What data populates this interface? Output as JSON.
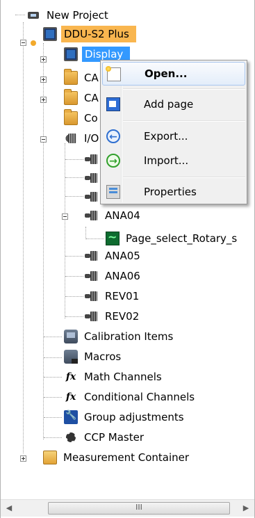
{
  "tree": {
    "root_label": "New Project",
    "device_label": "DDU-S2 Plus",
    "display_label": "Display",
    "ca1_label": "CA",
    "ca2_label": "CA",
    "co_label": "Co",
    "io_label": "I/O",
    "ana04_label": "ANA04",
    "page_select_label": "Page_select_Rotary_s",
    "ana05_label": "ANA05",
    "ana06_label": "ANA06",
    "rev01_label": "REV01",
    "rev02_label": "REV02",
    "calibration_label": "Calibration Items",
    "macros_label": "Macros",
    "math_label": "Math Channels",
    "conditional_label": "Conditional Channels",
    "group_label": "Group adjustments",
    "ccp_label": "CCP Master",
    "measurement_label": "Measurement Container"
  },
  "context_menu": {
    "open": "Open...",
    "add_page": "Add page",
    "export": "Export...",
    "import": "Import...",
    "properties": "Properties"
  },
  "icons": {
    "fx": "fx",
    "export_arrow": "←",
    "import_arrow": "→"
  },
  "scrollbar": {
    "left_arrow": "◀",
    "right_arrow": "▶",
    "grip": "III"
  },
  "colors": {
    "device_selection": "#f9b64f",
    "display_selection": "#3399ff",
    "menu_hover": "#e3edfa"
  }
}
